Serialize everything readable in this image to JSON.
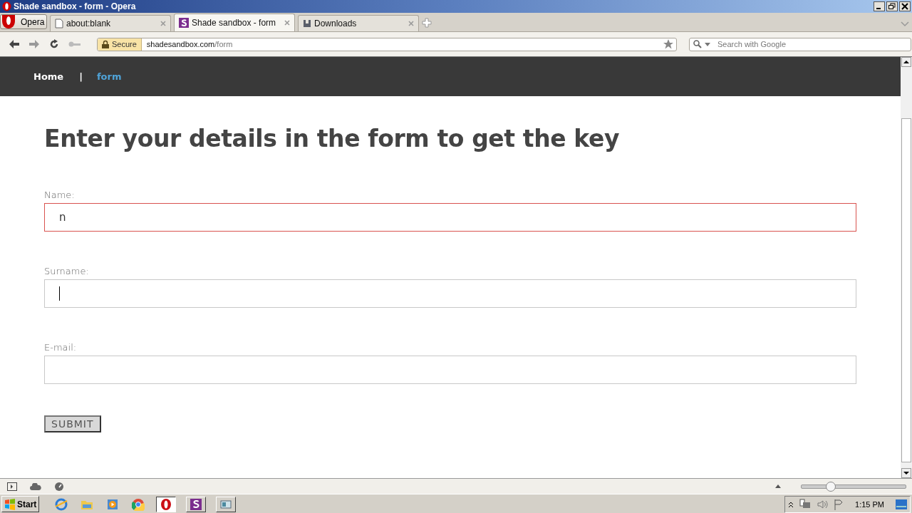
{
  "window": {
    "title": "Shade sandbox - form - Opera"
  },
  "menu_button": "Opera",
  "tabs": [
    {
      "label": "about:blank",
      "selected": false
    },
    {
      "label": "Shade sandbox - form",
      "selected": true
    },
    {
      "label": "Downloads",
      "selected": false
    }
  ],
  "address_bar": {
    "security": "Secure",
    "host": "shadesandbox.com",
    "path": "/form"
  },
  "search": {
    "placeholder": "Search with Google"
  },
  "site_nav": {
    "items": [
      {
        "label": "Home",
        "selected": false
      },
      {
        "label": "form",
        "selected": true
      }
    ],
    "separator": "|"
  },
  "heading": "Enter your details in the form to get the key",
  "fields": [
    {
      "label": "Name:",
      "value": "n",
      "invalid": true,
      "focused": false
    },
    {
      "label": "Surname:",
      "invalid": false,
      "focused": true
    },
    {
      "label": "E-mail:",
      "invalid": false,
      "focused": false
    }
  ],
  "submit": "SUBMIT",
  "status_bar": {
    "zoom": {
      "level": 0.28
    }
  },
  "taskbar": {
    "start": "Start",
    "apps": [
      {
        "selected": false
      },
      {
        "selected": false
      },
      {
        "selected": false
      },
      {
        "selected": false
      },
      {
        "selected": true
      },
      {
        "selected": false
      },
      {
        "selected": false
      }
    ],
    "clock": "1:15 PM"
  }
}
